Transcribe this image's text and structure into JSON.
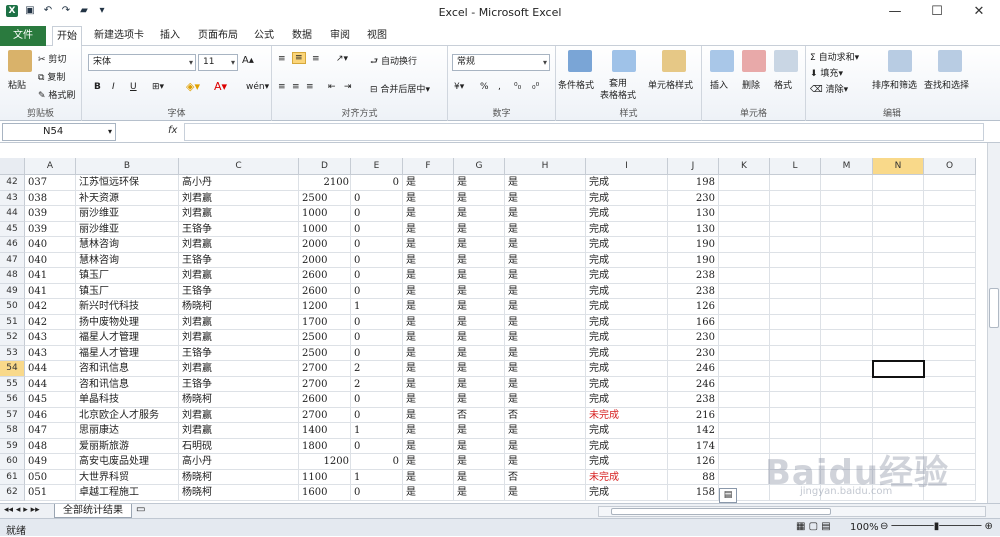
{
  "window": {
    "title": "Excel - Microsoft Excel",
    "controls": [
      "—",
      "☐",
      "✕"
    ]
  },
  "tabs": [
    "文件",
    "开始",
    "新建选项卡",
    "插入",
    "页面布局",
    "公式",
    "数据",
    "审阅",
    "视图"
  ],
  "ribbon": {
    "clipboard": {
      "label": "剪贴板",
      "paste": "粘贴",
      "cut": "剪切",
      "copy": "复制",
      "painter": "格式刷"
    },
    "font": {
      "label": "字体",
      "name": "宋体",
      "size": "11",
      "bold": "B",
      "italic": "I",
      "underline": "U",
      "wen": "wén"
    },
    "align": {
      "label": "对齐方式",
      "wrap": "自动换行",
      "merge": "合并后居中"
    },
    "number": {
      "label": "数字",
      "format": "常规",
      "pct": "%",
      "comma": ","
    },
    "styles": {
      "label": "样式",
      "cond": "条件格式",
      "table": "套用\n表格格式",
      "cell": "单元格样式"
    },
    "cells": {
      "label": "单元格",
      "insert": "插入",
      "delete": "删除",
      "format": "格式"
    },
    "edit": {
      "label": "编辑",
      "autosum": "自动求和",
      "fill": "填充",
      "clear": "清除",
      "sort": "排序和筛选",
      "find": "查找和选择"
    }
  },
  "formula_bar": {
    "name_box": "N54",
    "fx": "fx",
    "value": ""
  },
  "columns": [
    "A",
    "B",
    "C",
    "D",
    "E",
    "F",
    "G",
    "H",
    "I",
    "J",
    "K",
    "L",
    "M",
    "N",
    "O"
  ],
  "rows": [
    {
      "n": "42",
      "a": "037",
      "b": "江苏恒远环保",
      "c": "高小丹",
      "d": "2100",
      "e": "0",
      "f": "是",
      "g": "是",
      "h": "是",
      "i": "完成",
      "j": "198",
      "dr": true
    },
    {
      "n": "43",
      "a": "038",
      "b": "补天资源",
      "c": "刘君赢",
      "d": "2500",
      "e": "0",
      "f": "是",
      "g": "是",
      "h": "是",
      "i": "完成",
      "j": "230"
    },
    {
      "n": "44",
      "a": "039",
      "b": "丽沙维亚",
      "c": "刘君赢",
      "d": "1000",
      "e": "0",
      "f": "是",
      "g": "是",
      "h": "是",
      "i": "完成",
      "j": "130"
    },
    {
      "n": "45",
      "a": "039",
      "b": "丽沙维亚",
      "c": "王铬争",
      "d": "1000",
      "e": "0",
      "f": "是",
      "g": "是",
      "h": "是",
      "i": "完成",
      "j": "130"
    },
    {
      "n": "46",
      "a": "040",
      "b": "慧林咨询",
      "c": "刘君赢",
      "d": "2000",
      "e": "0",
      "f": "是",
      "g": "是",
      "h": "是",
      "i": "完成",
      "j": "190"
    },
    {
      "n": "47",
      "a": "040",
      "b": "慧林咨询",
      "c": "王铬争",
      "d": "2000",
      "e": "0",
      "f": "是",
      "g": "是",
      "h": "是",
      "i": "完成",
      "j": "190"
    },
    {
      "n": "48",
      "a": "041",
      "b": "镇玉厂",
      "c": "刘君赢",
      "d": "2600",
      "e": "0",
      "f": "是",
      "g": "是",
      "h": "是",
      "i": "完成",
      "j": "238"
    },
    {
      "n": "49",
      "a": "041",
      "b": "镇玉厂",
      "c": "王铬争",
      "d": "2600",
      "e": "0",
      "f": "是",
      "g": "是",
      "h": "是",
      "i": "完成",
      "j": "238"
    },
    {
      "n": "50",
      "a": "042",
      "b": "新兴时代科技",
      "c": "杨晓柯",
      "d": "1200",
      "e": "1",
      "f": "是",
      "g": "是",
      "h": "是",
      "i": "完成",
      "j": "126"
    },
    {
      "n": "51",
      "a": "042",
      "b": "扬中废物处理",
      "c": "刘君赢",
      "d": "1700",
      "e": "0",
      "f": "是",
      "g": "是",
      "h": "是",
      "i": "完成",
      "j": "166"
    },
    {
      "n": "52",
      "a": "043",
      "b": "福星人才管理",
      "c": "刘君赢",
      "d": "2500",
      "e": "0",
      "f": "是",
      "g": "是",
      "h": "是",
      "i": "完成",
      "j": "230"
    },
    {
      "n": "53",
      "a": "043",
      "b": "福星人才管理",
      "c": "王铬争",
      "d": "2500",
      "e": "0",
      "f": "是",
      "g": "是",
      "h": "是",
      "i": "完成",
      "j": "230"
    },
    {
      "n": "54",
      "a": "044",
      "b": "咨和讯信息",
      "c": "刘君赢",
      "d": "2700",
      "e": "2",
      "f": "是",
      "g": "是",
      "h": "是",
      "i": "完成",
      "j": "246"
    },
    {
      "n": "55",
      "a": "044",
      "b": "咨和讯信息",
      "c": "王铬争",
      "d": "2700",
      "e": "2",
      "f": "是",
      "g": "是",
      "h": "是",
      "i": "完成",
      "j": "246"
    },
    {
      "n": "56",
      "a": "045",
      "b": "单晶科技",
      "c": "杨晓柯",
      "d": "2600",
      "e": "0",
      "f": "是",
      "g": "是",
      "h": "是",
      "i": "完成",
      "j": "238"
    },
    {
      "n": "57",
      "a": "046",
      "b": "北京欧企人才服务",
      "c": "刘君赢",
      "d": "2700",
      "e": "0",
      "f": "是",
      "g": "否",
      "h": "否",
      "i": "未完成",
      "j": "216",
      "red": true
    },
    {
      "n": "58",
      "a": "047",
      "b": "思丽康达",
      "c": "刘君赢",
      "d": "1400",
      "e": "1",
      "f": "是",
      "g": "是",
      "h": "是",
      "i": "完成",
      "j": "142"
    },
    {
      "n": "59",
      "a": "048",
      "b": "爱丽斯旅游",
      "c": "石明砚",
      "d": "1800",
      "e": "0",
      "f": "是",
      "g": "是",
      "h": "是",
      "i": "完成",
      "j": "174"
    },
    {
      "n": "60",
      "a": "049",
      "b": "高安屯废品处理",
      "c": "高小丹",
      "d": "1200",
      "e": "0",
      "f": "是",
      "g": "是",
      "h": "是",
      "i": "完成",
      "j": "126",
      "dr": true
    },
    {
      "n": "61",
      "a": "050",
      "b": "大世界科贸",
      "c": "杨晓柯",
      "d": "1100",
      "e": "1",
      "f": "是",
      "g": "是",
      "h": "否",
      "i": "未完成",
      "j": "88",
      "red": true
    },
    {
      "n": "62",
      "a": "051",
      "b": "卓越工程施工",
      "c": "杨晓柯",
      "d": "1600",
      "e": "0",
      "f": "是",
      "g": "是",
      "h": "是",
      "i": "完成",
      "j": "158"
    }
  ],
  "sheet": {
    "name": "全部统计结果"
  },
  "status": {
    "ready": "就绪",
    "zoom": "100%"
  },
  "watermark": {
    "main": "Baidu经验",
    "sub": "jingyan.baidu.com"
  }
}
